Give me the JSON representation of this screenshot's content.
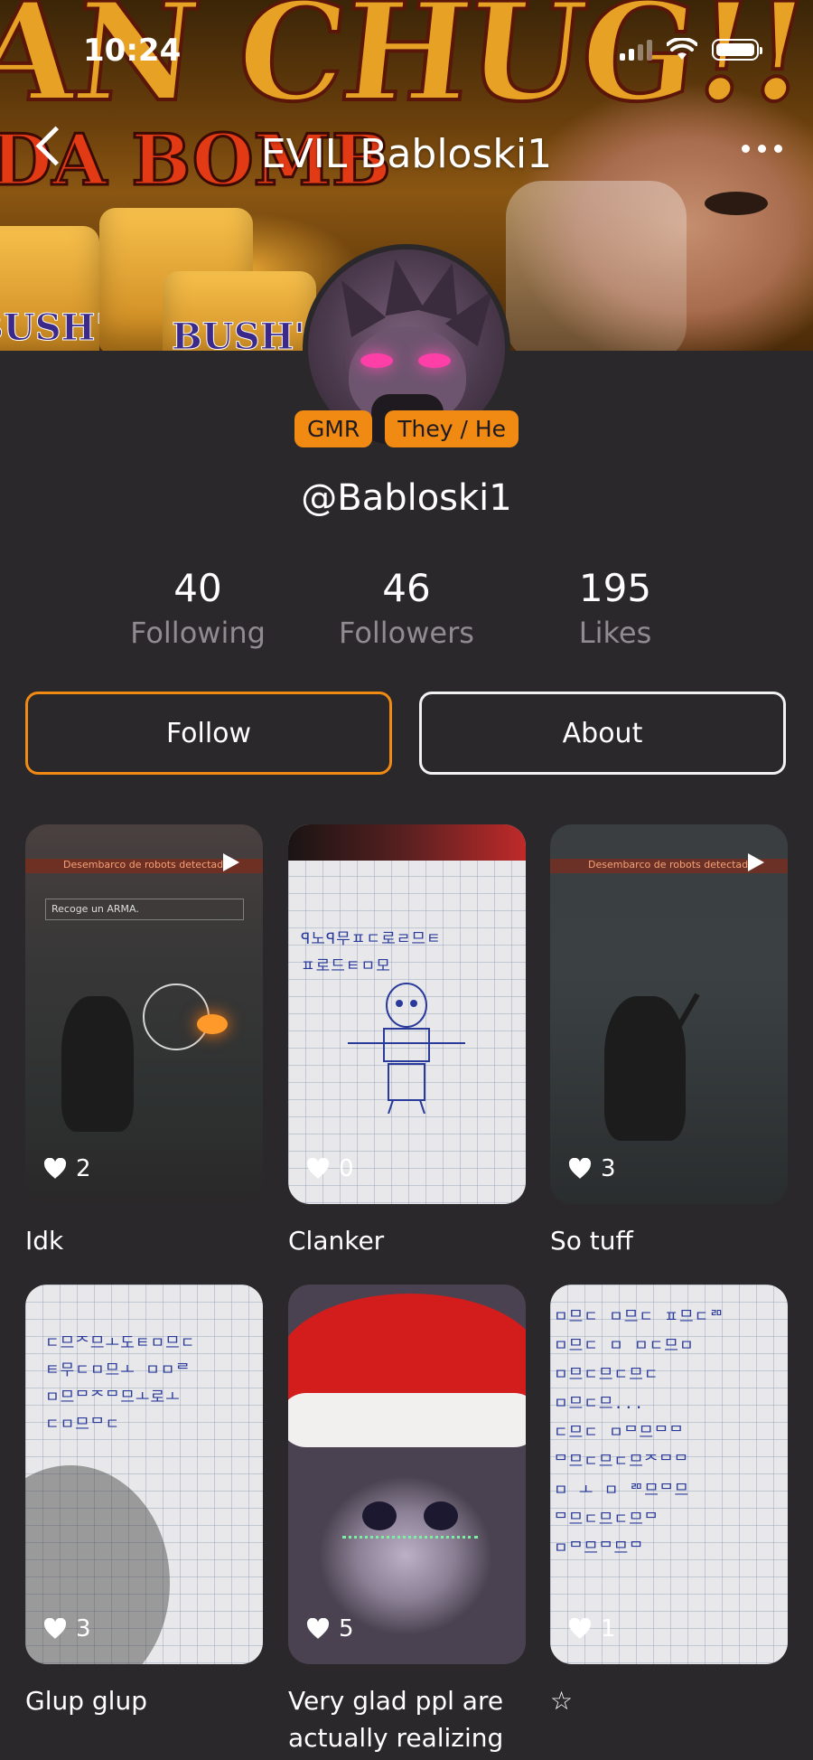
{
  "status_bar": {
    "time": "10:24"
  },
  "header": {
    "title": "EVIL Babloski1",
    "banner_text_big": "AN CHUG!!",
    "banner_text_sub": "DA BOMB",
    "banner_can_text": "BUSH'S"
  },
  "profile": {
    "badges": [
      "GMR",
      "They / He"
    ],
    "handle": "@Babloski1",
    "stats": [
      {
        "value": "40",
        "label": "Following"
      },
      {
        "value": "46",
        "label": "Followers"
      },
      {
        "value": "195",
        "label": "Likes"
      }
    ]
  },
  "actions": {
    "follow_label": "Follow",
    "about_label": "About"
  },
  "posts": [
    {
      "caption": "Idk",
      "likes": "2",
      "video": true,
      "hud_text": "Desembarco de robots detectado",
      "hud_hint": "Recoge un ARMA."
    },
    {
      "caption": "Clanker",
      "likes": "0",
      "video": false
    },
    {
      "caption": "So tuff",
      "likes": "3",
      "video": true,
      "hud_text": "Desembarco de robots detectado"
    },
    {
      "caption": "Glup glup",
      "likes": "3",
      "video": false
    },
    {
      "caption": "Very glad ppl are actually realizing",
      "likes": "5",
      "video": false
    },
    {
      "caption": "☆",
      "likes": "1",
      "video": false
    }
  ],
  "colors": {
    "background": "#2b282b",
    "accent": "#f08a13",
    "muted_text": "#8f8b90",
    "writing_ink": "#2a3a9a"
  },
  "icons": {
    "back": "chevron-left-icon",
    "more": "more-horizontal-icon",
    "like": "heart-icon",
    "video": "play-icon"
  }
}
